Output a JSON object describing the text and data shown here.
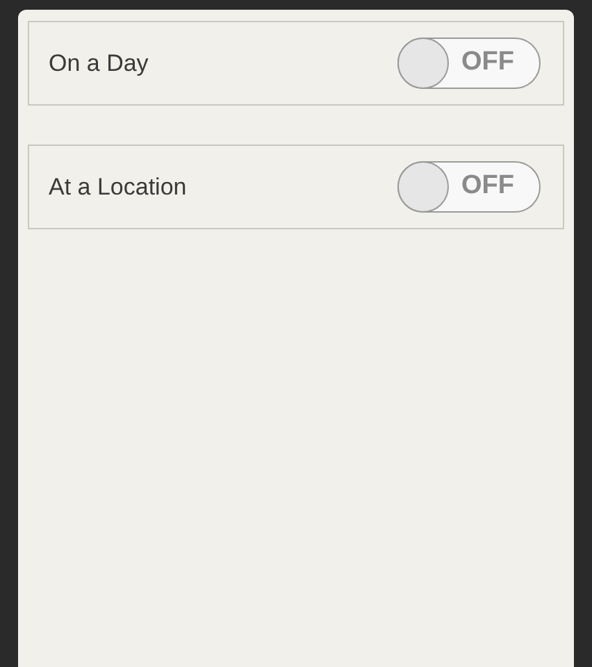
{
  "reminders": [
    {
      "label": "On a Day",
      "on": false,
      "toggle_text": "OFF"
    },
    {
      "label": "At a Location",
      "on": false,
      "toggle_text": "OFF"
    }
  ]
}
